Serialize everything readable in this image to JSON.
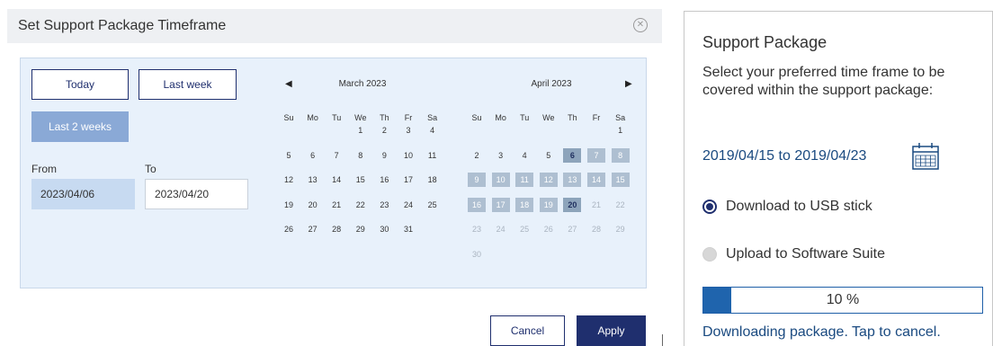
{
  "dialog": {
    "title": "Set Support Package Timeframe",
    "close_icon": "close-circle-icon",
    "quick_buttons": {
      "today": "Today",
      "last_week": "Last week",
      "last_2_weeks": "Last 2 weeks"
    },
    "from_label": "From",
    "to_label": "To",
    "from_value": "2023/04/06",
    "to_value": "2023/04/20",
    "cancel_label": "Cancel",
    "apply_label": "Apply"
  },
  "calendars": [
    {
      "title": "March 2023",
      "days_of_week": [
        "Su",
        "Mo",
        "Tu",
        "We",
        "Th",
        "Fr",
        "Sa"
      ],
      "weeks": [
        [
          "",
          "",
          "",
          "1",
          "2",
          "3",
          "4"
        ],
        [
          "5",
          "6",
          "7",
          "8",
          "9",
          "10",
          "11"
        ],
        [
          "12",
          "13",
          "14",
          "15",
          "16",
          "17",
          "18"
        ],
        [
          "19",
          "20",
          "21",
          "22",
          "23",
          "24",
          "25"
        ],
        [
          "26",
          "27",
          "28",
          "29",
          "30",
          "31",
          ""
        ]
      ]
    },
    {
      "title": "April 2023",
      "days_of_week": [
        "Su",
        "Mo",
        "Tu",
        "We",
        "Th",
        "Fr",
        "Sa"
      ],
      "weeks": [
        [
          "",
          "",
          "",
          "",
          "",
          "",
          "1"
        ],
        [
          "2",
          "3",
          "4",
          "5",
          "6",
          "7",
          "8"
        ],
        [
          "9",
          "10",
          "11",
          "12",
          "13",
          "14",
          "15"
        ],
        [
          "16",
          "17",
          "18",
          "19",
          "20",
          "21",
          "22"
        ],
        [
          "23",
          "24",
          "25",
          "26",
          "27",
          "28",
          "29"
        ],
        [
          "30",
          "",
          "",
          "",
          "",
          "",
          ""
        ]
      ],
      "range_start": 6,
      "range_end": 20,
      "muted_from": 21
    }
  ],
  "nav": {
    "prev_icon": "triangle-left-icon",
    "next_icon": "triangle-right-icon"
  },
  "support_card": {
    "title": "Support Package",
    "description": "Select your preferred time frame to be covered within the support package:",
    "date_range": "2019/04/15 to 2019/04/23",
    "calendar_icon": "calendar-icon",
    "options": [
      {
        "label": "Download to USB stick",
        "selected": true
      },
      {
        "label": "Upload to Software Suite",
        "selected": false
      }
    ],
    "progress_percent": 10,
    "progress_text": "10 %",
    "status": "Downloading package. Tap to cancel."
  },
  "colors": {
    "accent": "#1f2f6e",
    "range": "#aebfd1",
    "range_edge": "#8da4bb",
    "panel_bg": "#e8f1fb",
    "link_text": "#1a4a80",
    "progress_fill": "#1f64ad"
  }
}
